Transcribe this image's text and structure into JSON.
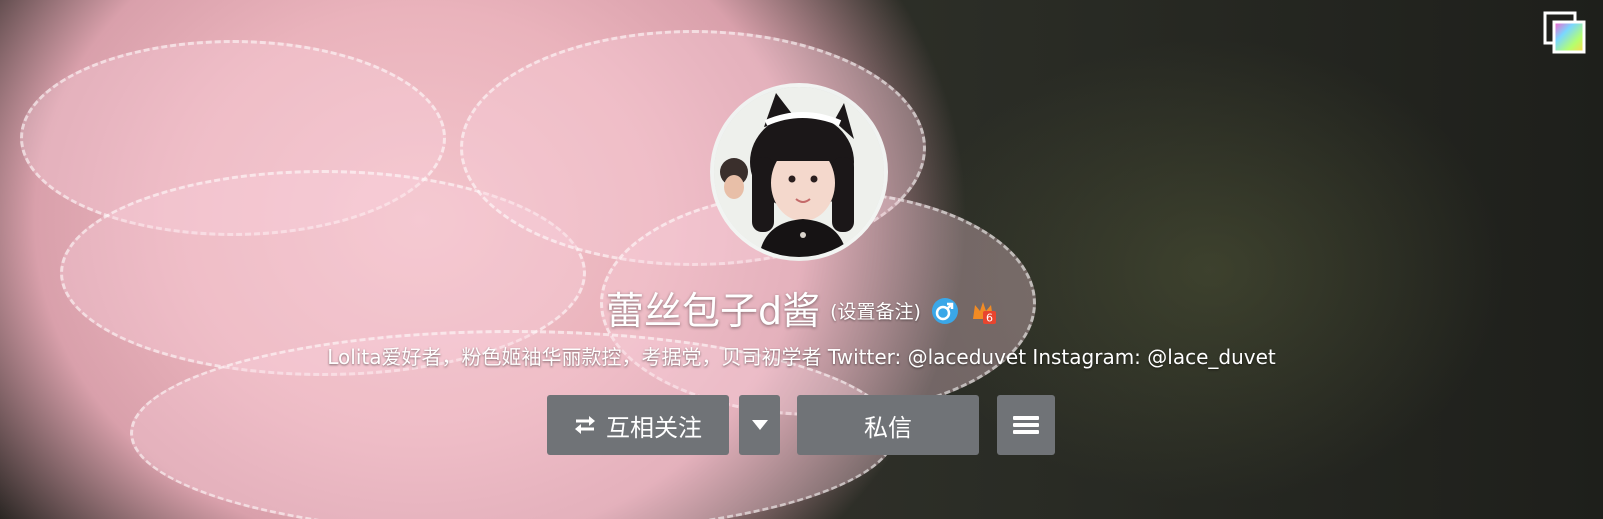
{
  "profile": {
    "name": "蕾丝包子d酱",
    "remark_label": "(设置备注)",
    "bio": "Lolita爱好者，粉色姬袖华丽款控，考据党，贝司初学者 Twitter: @laceduvet Instagram: @lace_duvet",
    "gender_icon": "male-icon",
    "level_badge": "6"
  },
  "actions": {
    "follow_label": "互相关注",
    "follow_icon": "mutual-arrows-icon",
    "dropdown_icon": "caret-down-icon",
    "message_label": "私信",
    "menu_icon": "hamburger-icon"
  },
  "corner": {
    "icon": "cover-image-icon"
  },
  "colors": {
    "button_bg": "#707377",
    "gender_blue": "#3aa7e8",
    "badge_orange": "#f28b24",
    "badge_red": "#e8452f"
  }
}
